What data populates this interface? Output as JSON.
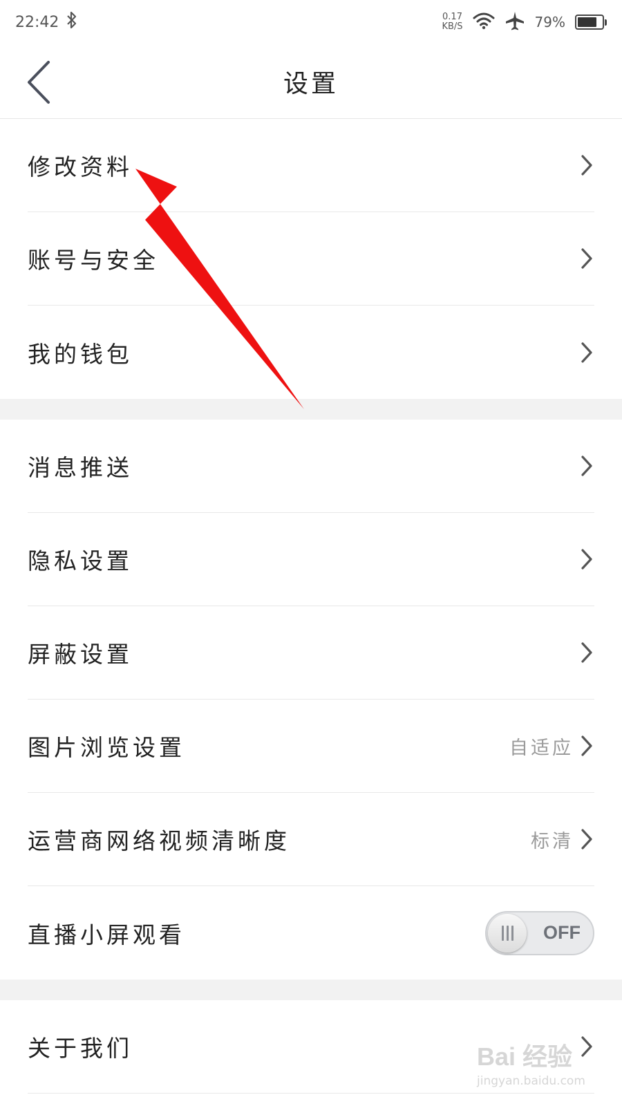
{
  "status_bar": {
    "time": "22:42",
    "bluetooth_icon": "bluetooth-icon",
    "net_speed_value": "0.17",
    "net_speed_unit": "KB/S",
    "wifi_icon": "wifi-icon",
    "airplane_icon": "airplane-icon",
    "battery_percent": "79%",
    "battery_level": 0.79
  },
  "nav": {
    "title": "设置",
    "back_icon": "chevron-left-icon"
  },
  "section1": {
    "items": [
      {
        "label": "修改资料"
      },
      {
        "label": "账号与安全"
      },
      {
        "label": "我的钱包"
      }
    ]
  },
  "section2": {
    "items": [
      {
        "label": "消息推送"
      },
      {
        "label": "隐私设置"
      },
      {
        "label": "屏蔽设置"
      },
      {
        "label": "图片浏览设置",
        "value": "自适应"
      },
      {
        "label": "运营商网络视频清晰度",
        "value": "标清"
      },
      {
        "label": "直播小屏观看",
        "toggle_text": "OFF",
        "toggle_on": false
      }
    ]
  },
  "section3": {
    "items": [
      {
        "label": "关于我们"
      }
    ]
  },
  "colors": {
    "background": "#ffffff",
    "section_gap": "#f2f2f2",
    "annotation_arrow": "#ee1111",
    "secondary_text": "#9a9a9a"
  },
  "watermark": {
    "brand": "Bai 经验",
    "url": "jingyan.baidu.com"
  }
}
